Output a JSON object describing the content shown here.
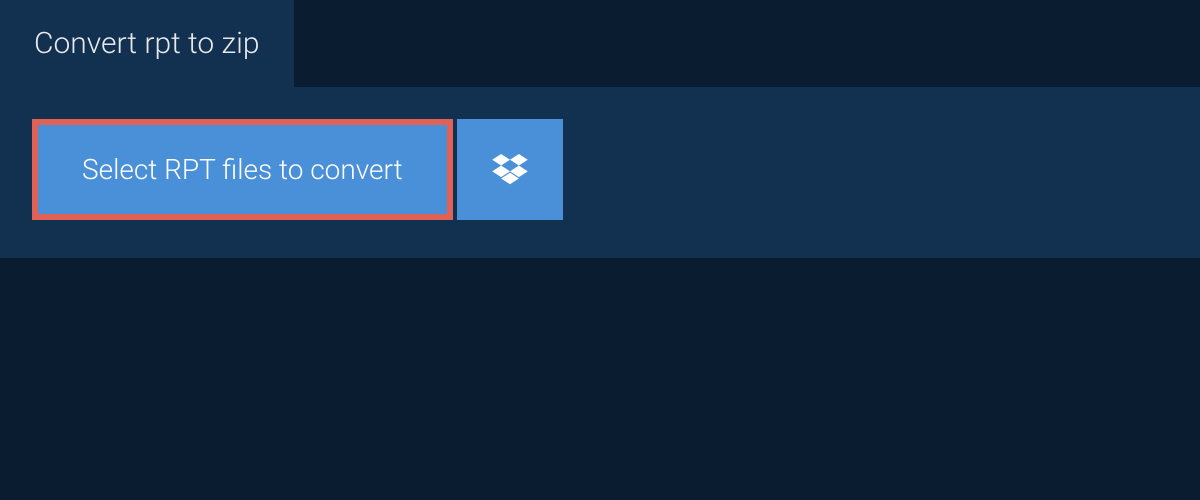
{
  "tab": {
    "title": "Convert rpt to zip"
  },
  "actions": {
    "select_files_label": "Select RPT files to convert",
    "dropbox_icon": "dropbox-icon"
  },
  "colors": {
    "background": "#0a1c30",
    "panel": "#12304f",
    "button": "#4a90d9",
    "highlight_border": "#e06257",
    "text_light": "#ffffff"
  }
}
